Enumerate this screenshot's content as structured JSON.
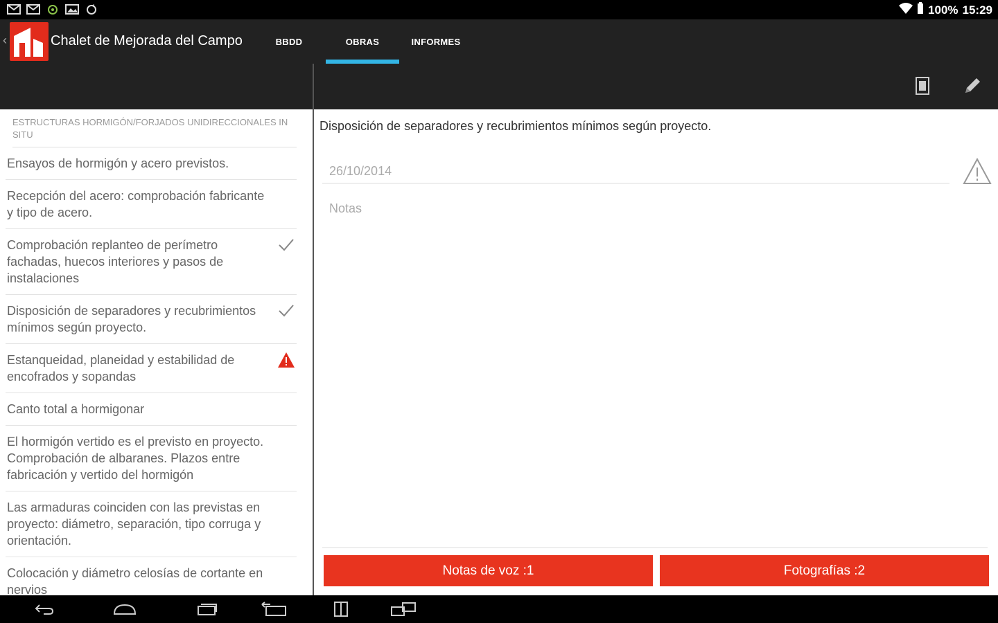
{
  "status_bar": {
    "battery": "100%",
    "time": "15:29",
    "icons": [
      "mail-icon",
      "mail-icon",
      "android-icon",
      "image-icon",
      "sync-icon"
    ]
  },
  "action_bar": {
    "title": "Chalet de Mejorada del Campo",
    "tabs": [
      {
        "label": "BBDD",
        "selected": false
      },
      {
        "label": "OBRAS",
        "selected": true
      },
      {
        "label": "INFORMES",
        "selected": false
      }
    ],
    "accent": "#33b5e5"
  },
  "list": {
    "section_header": "ESTRUCTURAS HORMIGÓN/FORJADOS UNIDIRECCIONALES IN SITU",
    "items": [
      {
        "label": "Ensayos de hormigón y acero previstos.",
        "status": "none"
      },
      {
        "label": "Recepción del acero: comprobación fabricante y tipo de acero.",
        "status": "none"
      },
      {
        "label": "Comprobación replanteo de perímetro fachadas, huecos interiores y pasos de instalaciones",
        "status": "check"
      },
      {
        "label": "Disposición de separadores y recubrimientos mínimos según proyecto.",
        "status": "check"
      },
      {
        "label": "Estanqueidad, planeidad y estabilidad de encofrados y sopandas",
        "status": "warning"
      },
      {
        "label": "Canto total a hormigonar",
        "status": "none"
      },
      {
        "label": "El hormigón vertido es el previsto en proyecto. Comprobación de albaranes. Plazos entre fabricación y vertido del hormigón",
        "status": "none"
      },
      {
        "label": "Las armaduras coinciden con las previstas en proyecto: diámetro, separación, tipo corruga y orientación.",
        "status": "none"
      },
      {
        "label": "Colocación y diámetro celosías de cortante en nervios",
        "status": "none"
      }
    ]
  },
  "detail": {
    "title": "Disposición de separadores y recubrimientos mínimos según proyecto.",
    "date": "26/10/2014",
    "notes_placeholder": "Notas",
    "voice_notes_button": "Notas de voz :1",
    "photos_button": "Fotografías :2"
  },
  "colors": {
    "brand_red": "#e8341f",
    "warning_red": "#e22c1c"
  }
}
